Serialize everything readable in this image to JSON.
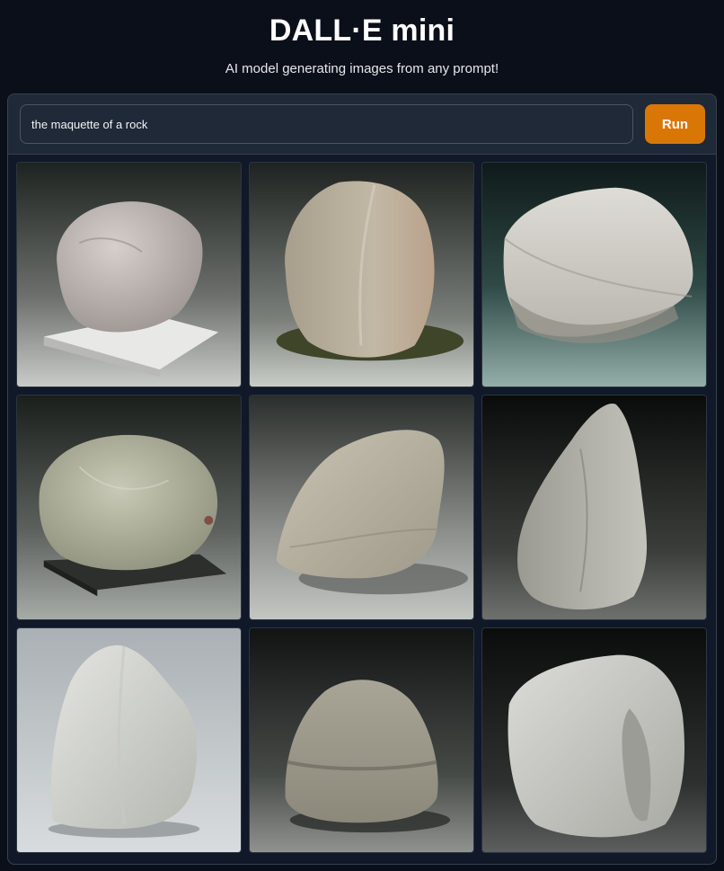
{
  "header": {
    "title": "DALL·E mini",
    "subtitle": "AI model generating images from any prompt!"
  },
  "prompt": {
    "value": "the maquette of a rock",
    "run_label": "Run"
  },
  "gallery": {
    "images": [
      {
        "subject": "pale rock on white base"
      },
      {
        "subject": "tan rock on olive shadow"
      },
      {
        "subject": "speckled white rock on teal"
      },
      {
        "subject": "green-grey rock on black base"
      },
      {
        "subject": "beige rock on grey"
      },
      {
        "subject": "tall grey rock on dark background"
      },
      {
        "subject": "white block rock on light grey"
      },
      {
        "subject": "grey layered rock on dark background"
      },
      {
        "subject": "smooth white rock on dark background"
      }
    ]
  }
}
